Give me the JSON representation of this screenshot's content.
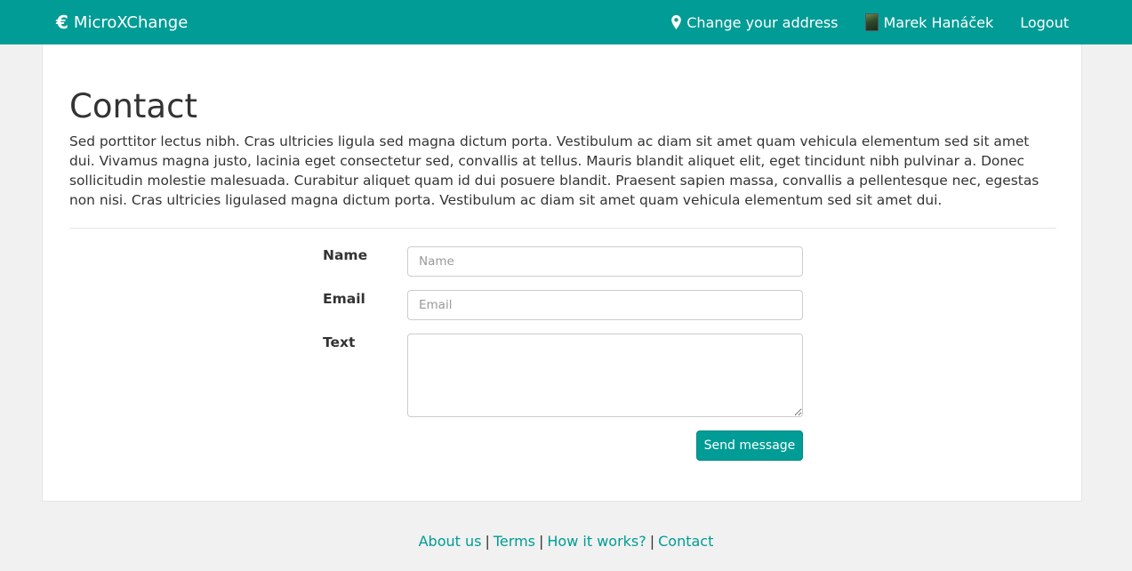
{
  "navbar": {
    "brand_icon": "euro-icon",
    "brand_label": "MicroXChange",
    "change_address_icon": "map-pin-icon",
    "change_address_label": "Change your address",
    "user_name": "Marek Hanáček",
    "logout_label": "Logout",
    "background_color": "#009c95"
  },
  "main": {
    "title": "Contact",
    "intro": "Sed porttitor lectus nibh. Cras ultricies ligula sed magna dictum porta. Vestibulum ac diam sit amet quam vehicula elementum sed sit amet dui. Vivamus magna justo, lacinia eget consectetur sed, convallis at tellus. Mauris blandit aliquet elit, eget tincidunt nibh pulvinar a. Donec sollicitudin molestie malesuada. Curabitur aliquet quam id dui posuere blandit. Praesent sapien massa, convallis a pellentesque nec, egestas non nisi. Cras ultricies ligulased magna dictum porta. Vestibulum ac diam sit amet quam vehicula elementum sed sit amet dui."
  },
  "form": {
    "name_label": "Name",
    "name_placeholder": "Name",
    "name_value": "",
    "email_label": "Email",
    "email_placeholder": "Email",
    "email_value": "",
    "text_label": "Text",
    "text_value": "",
    "submit_label": "Send message"
  },
  "footer": {
    "links": [
      "About us",
      "Terms",
      "How it works?",
      "Contact"
    ],
    "separator": "|",
    "link_color": "#009c95"
  }
}
